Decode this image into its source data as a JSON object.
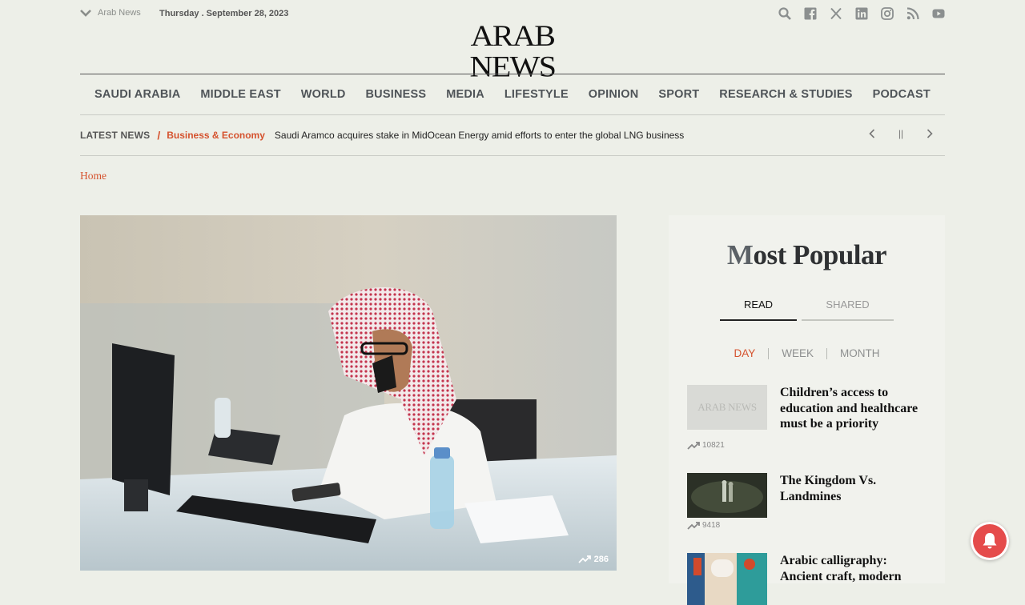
{
  "topbar": {
    "edition": "Arab News",
    "date": "Thursday .  September 28, 2023"
  },
  "logo": "ARAB NEWS",
  "nav": {
    "items": [
      "SAUDI ARABIA",
      "MIDDLE EAST",
      "WORLD",
      "BUSINESS",
      "MEDIA",
      "LIFESTYLE",
      "OPINION",
      "SPORT",
      "RESEARCH & STUDIES",
      "PODCAST"
    ]
  },
  "ticker": {
    "label": "LATEST NEWS",
    "separator": "/",
    "category": "Business & Economy",
    "headline": "Saudi Aramco acquires stake in MidOcean Energy amid efforts to enter the global LNG business",
    "pause": "||"
  },
  "breadcrumb": "Home",
  "hero": {
    "views": "286"
  },
  "sidebar": {
    "title_first": "M",
    "title_rest": "ost Popular",
    "tabs": [
      "READ",
      "SHARED"
    ],
    "periods": [
      "DAY",
      "WEEK",
      "MONTH"
    ],
    "items": [
      {
        "title": "Children’s access to education and healthcare must be a priority",
        "views": "10821",
        "thumb_text": "ARAB NEWS"
      },
      {
        "title": "The Kingdom Vs. Landmines",
        "views": "9418"
      },
      {
        "title": "Arabic calligraphy: Ancient craft, modern"
      }
    ]
  },
  "colors": {
    "accent": "#d5522e",
    "background": "#edefe8",
    "bell": "#e54b4b"
  }
}
